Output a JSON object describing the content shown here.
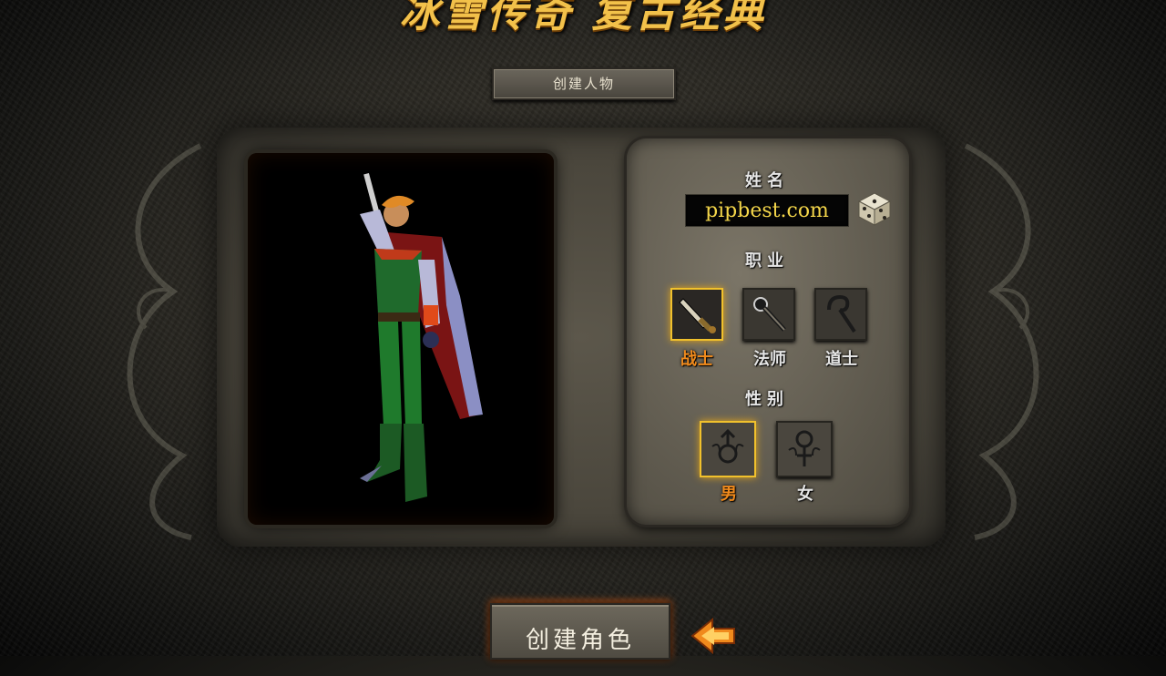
{
  "banner": {
    "title": "冰雪传奇 复古经典"
  },
  "header": {
    "title": "创建人物"
  },
  "form": {
    "name_label": "姓名",
    "name_value": "pipbest.com",
    "class_label": "职业",
    "classes": [
      {
        "label": "战士",
        "icon": "sword-icon",
        "selected": true
      },
      {
        "label": "法师",
        "icon": "staff-orb-icon",
        "selected": false
      },
      {
        "label": "道士",
        "icon": "crook-staff-icon",
        "selected": false
      }
    ],
    "gender_label": "性别",
    "genders": [
      {
        "label": "男",
        "icon": "male-symbol-icon",
        "selected": true
      },
      {
        "label": "女",
        "icon": "female-symbol-icon",
        "selected": false
      }
    ]
  },
  "actions": {
    "create_label": "创建角色"
  },
  "icons": {
    "random_name": "dice-icon",
    "pointer": "arrow-left-icon"
  },
  "colors": {
    "accent_gold": "#f2c14a",
    "selected_orange": "#f08a1c",
    "name_text": "#f4d64a"
  }
}
